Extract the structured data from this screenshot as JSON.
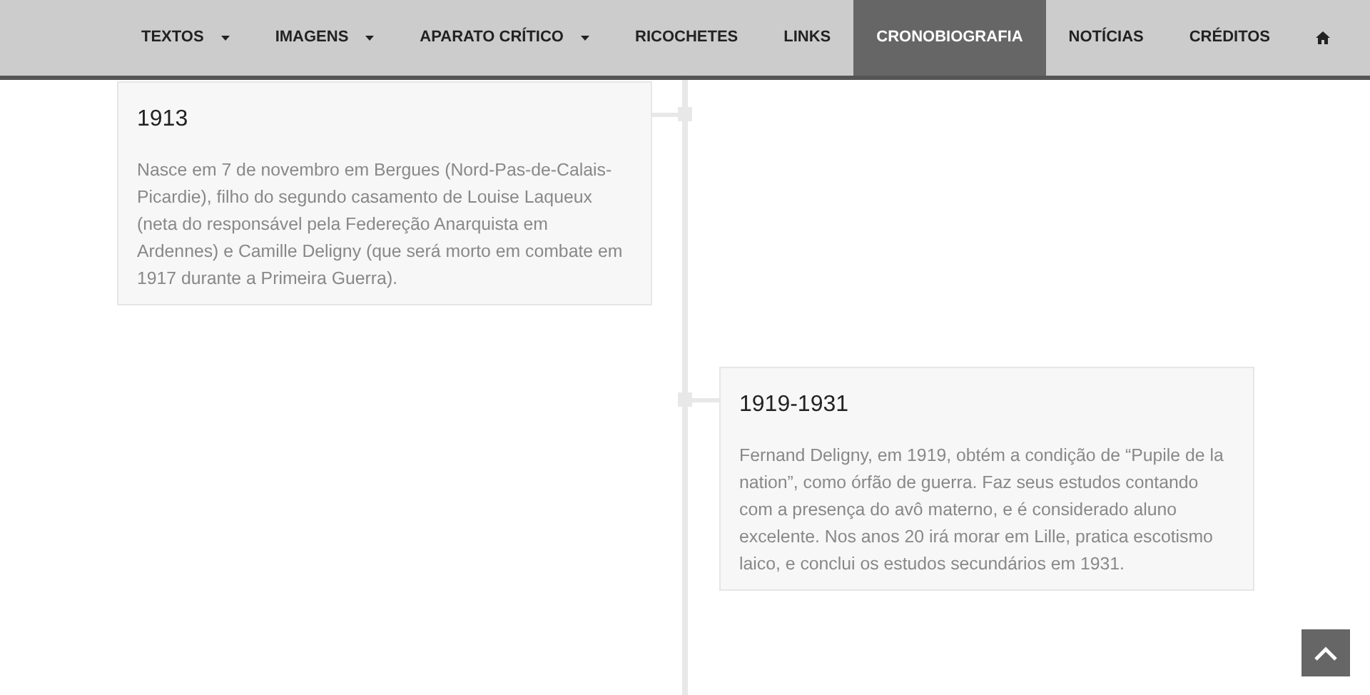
{
  "nav": [
    {
      "label": "TEXTOS",
      "dropdown": true,
      "selected": false
    },
    {
      "label": "IMAGENS",
      "dropdown": true,
      "selected": false
    },
    {
      "label": "APARATO CRÍTICO",
      "dropdown": true,
      "selected": false
    },
    {
      "label": "RICOCHETES",
      "dropdown": false,
      "selected": false
    },
    {
      "label": "LINKS",
      "dropdown": false,
      "selected": false
    },
    {
      "label": "CRONOBIOGRAFIA",
      "dropdown": false,
      "selected": true
    },
    {
      "label": "NOTÍCIAS",
      "dropdown": false,
      "selected": false
    },
    {
      "label": "CRÉDITOS",
      "dropdown": false,
      "selected": false
    },
    {
      "kind": "home",
      "selected": false
    }
  ],
  "timeline": [
    {
      "year": "1913",
      "text": "Nasce em 7 de novembro em Bergues (Nord-Pas-de-Calais-Picardie), filho do segundo casamento de Louise Laqueux (neta do responsável pela Federeção Anarquista em Ardennes) e Camille Deligny (que será morto em combate em 1917 durante a Primeira Guerra)."
    },
    {
      "year": "1919-1931",
      "text": "Fernand Deligny, em 1919, obtém a condição de “Pupile de la nation”, como órfão de guerra. Faz seus estudos contando com a presença do avô materno, e é considerado aluno excelente. Nos anos 20 irá morar em Lille, pratica escotismo laico, e conclui os estudos secundários em 1931."
    }
  ]
}
